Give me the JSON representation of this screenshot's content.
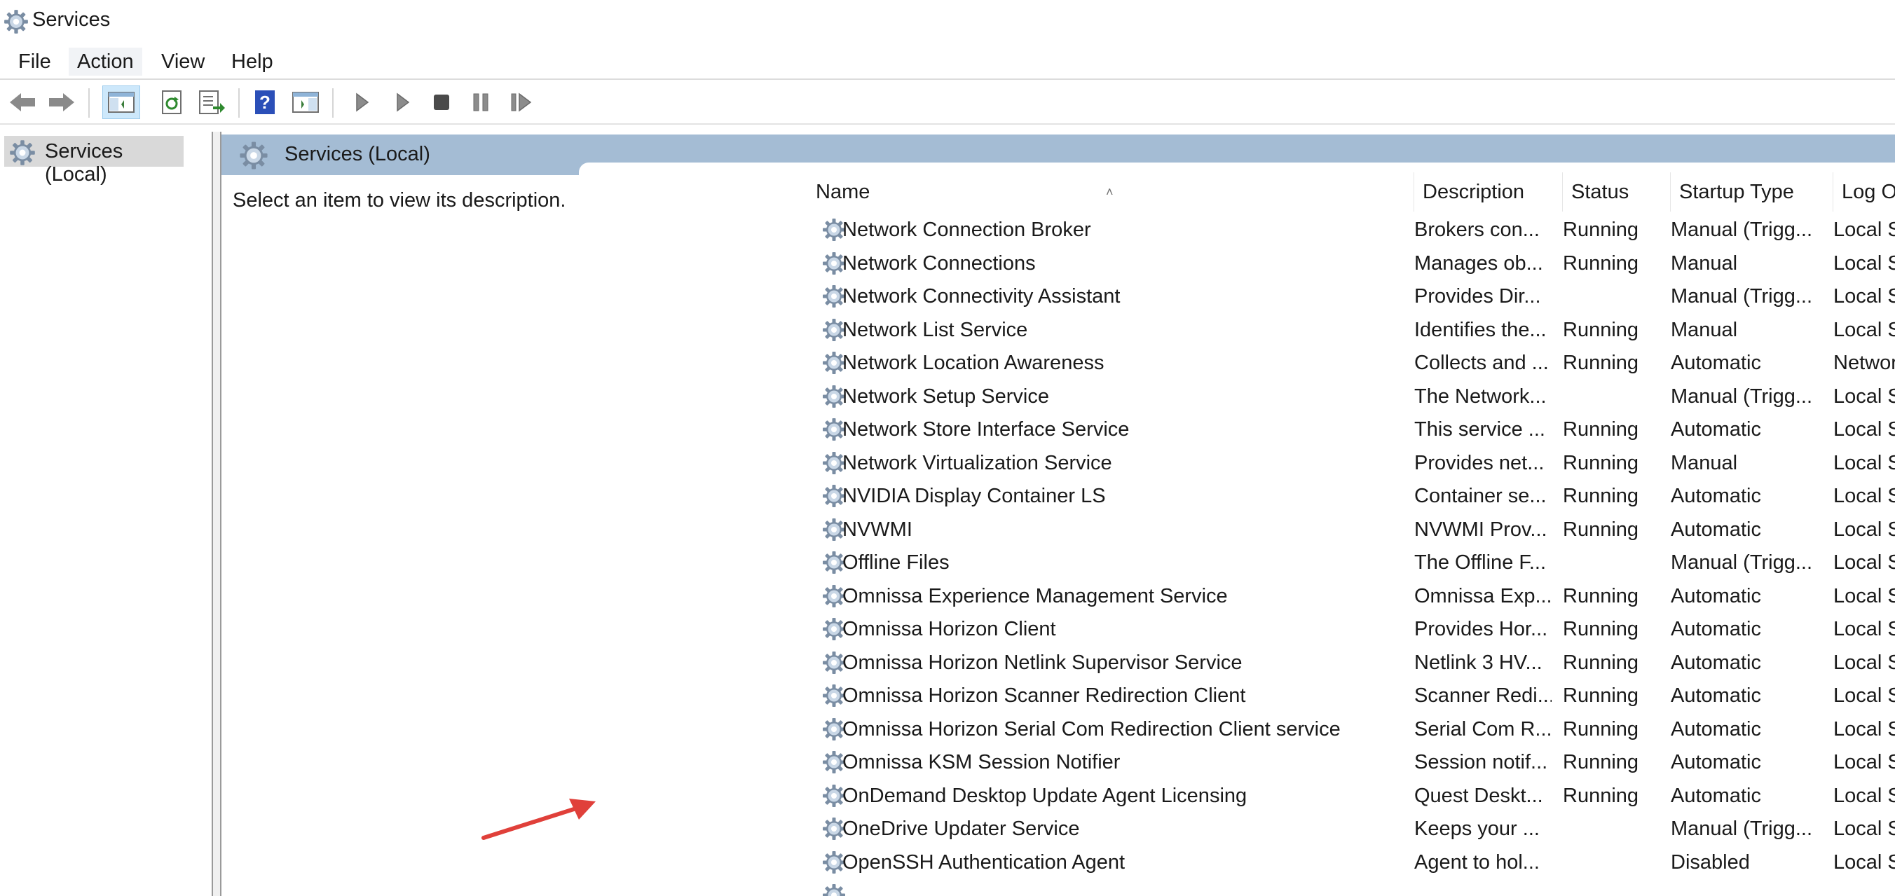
{
  "window": {
    "title": "Services"
  },
  "menu": [
    "File",
    "Action",
    "View",
    "Help"
  ],
  "toolbar": {
    "buttons": [
      "back-icon",
      "forward-icon",
      "show-hide-console-tree-icon",
      "refresh-icon",
      "export-list-icon",
      "help-icon",
      "properties-icon",
      "start-icon",
      "start-alt-icon",
      "stop-icon",
      "pause-icon",
      "restart-icon"
    ]
  },
  "tree": {
    "root_label": "Services (Local)"
  },
  "main": {
    "header_title": "Services (Local)",
    "description_prompt": "Select an item to view its description."
  },
  "columns": {
    "name": "Name",
    "description": "Description",
    "status": "Status",
    "startup_type": "Startup Type",
    "log_on_as": "Log On As"
  },
  "services": [
    {
      "name": "Network Connection Broker",
      "description": "Brokers con...",
      "status": "Running",
      "startup": "Manual (Trigg...",
      "logon": "Local System"
    },
    {
      "name": "Network Connections",
      "description": "Manages ob...",
      "status": "Running",
      "startup": "Manual",
      "logon": "Local System"
    },
    {
      "name": "Network Connectivity Assistant",
      "description": "Provides Dir...",
      "status": "",
      "startup": "Manual (Trigg...",
      "logon": "Local System"
    },
    {
      "name": "Network List Service",
      "description": "Identifies the...",
      "status": "Running",
      "startup": "Manual",
      "logon": "Local Service"
    },
    {
      "name": "Network Location Awareness",
      "description": "Collects and ...",
      "status": "Running",
      "startup": "Automatic",
      "logon": "Network Se..."
    },
    {
      "name": "Network Setup Service",
      "description": "The Network...",
      "status": "",
      "startup": "Manual (Trigg...",
      "logon": "Local System"
    },
    {
      "name": "Network Store Interface Service",
      "description": "This service ...",
      "status": "Running",
      "startup": "Automatic",
      "logon": "Local Service"
    },
    {
      "name": "Network Virtualization Service",
      "description": "Provides net...",
      "status": "Running",
      "startup": "Manual",
      "logon": "Local System"
    },
    {
      "name": "NVIDIA Display Container LS",
      "description": "Container se...",
      "status": "Running",
      "startup": "Automatic",
      "logon": "Local System"
    },
    {
      "name": "NVWMI",
      "description": "NVWMI Prov...",
      "status": "Running",
      "startup": "Automatic",
      "logon": "Local System"
    },
    {
      "name": "Offline Files",
      "description": "The Offline F...",
      "status": "",
      "startup": "Manual (Trigg...",
      "logon": "Local System"
    },
    {
      "name": "Omnissa Experience Management Service",
      "description": "Omnissa Exp...",
      "status": "Running",
      "startup": "Automatic",
      "logon": "Local System"
    },
    {
      "name": "Omnissa Horizon Client",
      "description": "Provides Hor...",
      "status": "Running",
      "startup": "Automatic",
      "logon": "Local System"
    },
    {
      "name": "Omnissa Horizon Netlink Supervisor Service",
      "description": "Netlink 3 HV...",
      "status": "Running",
      "startup": "Automatic",
      "logon": "Local System"
    },
    {
      "name": "Omnissa Horizon Scanner Redirection Client",
      "description": "Scanner Redi...",
      "status": "Running",
      "startup": "Automatic",
      "logon": "Local System"
    },
    {
      "name": "Omnissa Horizon Serial Com Redirection Client service",
      "description": "Serial Com R...",
      "status": "Running",
      "startup": "Automatic",
      "logon": "Local System"
    },
    {
      "name": "Omnissa KSM Session Notifier",
      "description": "Session notif...",
      "status": "Running",
      "startup": "Automatic",
      "logon": "Local System"
    },
    {
      "name": "OnDemand Desktop Update Agent Licensing",
      "description": "Quest Deskt...",
      "status": "Running",
      "startup": "Automatic",
      "logon": "Local System"
    },
    {
      "name": "OneDrive Updater Service",
      "description": "Keeps your ...",
      "status": "",
      "startup": "Manual (Trigg...",
      "logon": "Local System"
    },
    {
      "name": "OpenSSH Authentication Agent",
      "description": "Agent to hol...",
      "status": "",
      "startup": "Disabled",
      "logon": "Local System"
    },
    {
      "name": "",
      "description": "",
      "status": "",
      "startup": "",
      "logon": ""
    }
  ],
  "colors": {
    "header_band": "#a4bcd4",
    "annotation_arrow": "#e0403a",
    "tree_selected": "#d9d9d9"
  }
}
